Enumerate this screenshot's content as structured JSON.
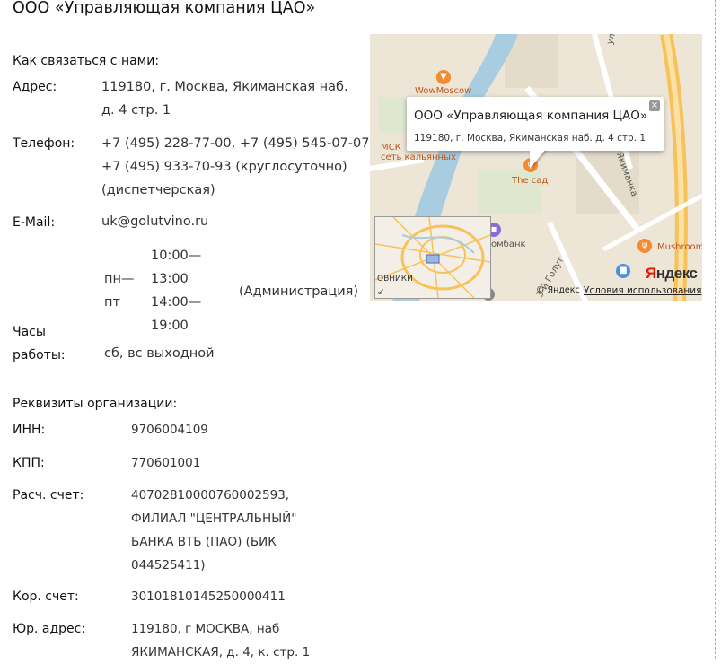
{
  "page": {
    "title": "ООО «Управляющая компания ЦАО»"
  },
  "contacts": {
    "heading": "Как связаться с нами:",
    "address_label": "Адрес:",
    "address_lines": [
      "119180, г. Москва, Якиманская наб.",
      "д. 4 стр. 1"
    ],
    "phone_label": "Телефон:",
    "phone_lines": [
      "+7 (495) 228-77-00, +7 (495) 545-07-07",
      "+7 (495) 933-70-93 (круглосуточно)",
      "(диспетчерская)"
    ],
    "email_label": "E-Mail:",
    "email": "uk@golutvino.ru",
    "hours_label": [
      "Часы",
      "работы:"
    ],
    "weekdays": [
      "пн—",
      "пт"
    ],
    "times": [
      "10:00—",
      "13:00",
      "14:00—",
      "19:00"
    ],
    "hours_note": "(Администрация)",
    "weekend": "сб, вс выходной"
  },
  "map": {
    "balloon_title": "ООО «Управляющая компания ЦАО»",
    "balloon_address": "119180, г. Москва, Якиманская наб. д. 4 стр. 1",
    "close_icon": "×",
    "labels": {
      "wowmoscow": "WowMoscow",
      "msk": "МСК",
      "hookah": "сеть кальянных",
      "thesad": "The сад",
      "bank": "омбанк",
      "mushroom": "Mushroom",
      "street1": "ул. Малая Якиманка",
      "street2": "Якиманка",
      "street3": "3-й Голут",
      "minimap_label": "ОВНИКИ",
      "minimap_arrow": "↙"
    },
    "logo_first": "Я",
    "logo_rest": "ндекс",
    "copyright": "© Яндекс",
    "terms": "Условия использования"
  },
  "requisites": {
    "heading": "Реквизиты организации:",
    "rows": [
      {
        "label": "ИНН:",
        "lines": [
          "9706004109"
        ]
      },
      {
        "label": "КПП:",
        "lines": [
          "770601001"
        ]
      },
      {
        "label": "Расч. счет:",
        "lines": [
          "40702810000760002593,",
          "ФИЛИАЛ \"ЦЕНТРАЛЬНЫЙ\"",
          "БАНКА ВТБ (ПАО) (БИК",
          "044525411)"
        ]
      },
      {
        "label": "Кор. счет:",
        "lines": [
          "30101810145250000411"
        ]
      },
      {
        "label": "Юр. адрес:",
        "lines": [
          "119180, г МОСКВА, наб",
          "ЯКИМАНСКАЯ, д. 4, к. стр. 1"
        ]
      }
    ]
  },
  "colors": {
    "accent_orange": "#f28b31",
    "river": "#a9cde0",
    "road": "#f7c25a",
    "divider": "#8ab4d9"
  }
}
